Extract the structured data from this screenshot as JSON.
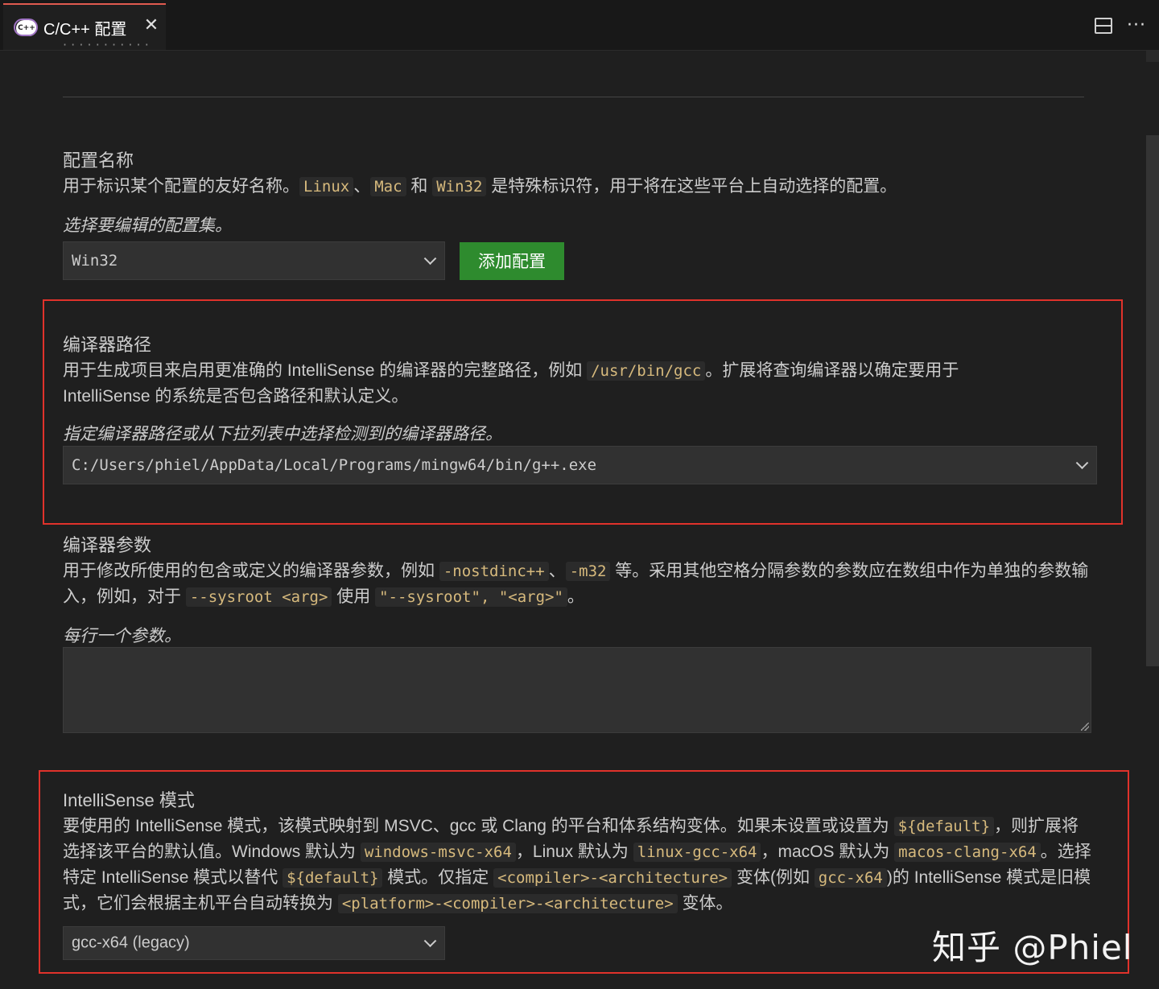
{
  "tab": {
    "icon_text": "C++",
    "title": "C/C++ 配置",
    "close_glyph": "✕"
  },
  "toolbar": {
    "more_glyph": "···"
  },
  "clipped_text": "· · · · · · · · · · ·",
  "config_name": {
    "title": "配置名称",
    "desc_1": "用于标识某个配置的友好名称。",
    "code_linux": "Linux",
    "sep_1": "、",
    "code_mac": "Mac",
    "and": " 和 ",
    "code_win32": "Win32",
    "desc_2": " 是特殊标识符，用于将在这些平台上自动选择的配置。",
    "hint": "选择要编辑的配置集。",
    "selected": "Win32",
    "add_button": "添加配置"
  },
  "compiler_path": {
    "title": "编译器路径",
    "desc_1": "用于生成项目来启用更准确的 IntelliSense 的编译器的完整路径，例如 ",
    "code_example": "/usr/bin/gcc",
    "desc_2": "。扩展将查询编译器以确定要用于 IntelliSense 的系统是否包含路径和默认定义。",
    "hint": "指定编译器路径或从下拉列表中选择检测到的编译器路径。",
    "selected": "C:/Users/phiel/AppData/Local/Programs/mingw64/bin/g++.exe"
  },
  "compiler_args": {
    "title": "编译器参数",
    "desc_1": "用于修改所使用的包含或定义的编译器参数，例如 ",
    "code_1": "-nostdinc++",
    "sep_1": "、",
    "code_2": "-m32",
    "desc_2": " 等。采用其他空格分隔参数的参数应在数组中作为单独的参数输入，例如，对于 ",
    "code_3": "--sysroot <arg>",
    "desc_3": " 使用 ",
    "code_4": "\"--sysroot\", \"<arg>\"",
    "desc_4": "。",
    "hint": "每行一个参数。",
    "value": ""
  },
  "intellisense": {
    "title": "IntelliSense 模式",
    "desc_1": "要使用的 IntelliSense 模式，该模式映射到 MSVC、gcc 或 Clang 的平台和体系结构变体。如果未设置或设置为 ",
    "code_1": "${default}",
    "desc_2": "，则扩展将选择该平台的默认值。Windows 默认为 ",
    "code_2": "windows-msvc-x64",
    "desc_3": "，Linux 默认为 ",
    "code_3": "linux-gcc-x64",
    "desc_4": "，macOS 默认为 ",
    "code_4": "macos-clang-x64",
    "desc_5": "。选择特定 IntelliSense 模式以替代 ",
    "code_5": "${default}",
    "desc_6": " 模式。仅指定 ",
    "code_6": "<compiler>-<architecture>",
    "desc_7": " 变体(例如 ",
    "code_7": "gcc-x64",
    "desc_8": ")的 IntelliSense 模式是旧模式，它们会根据主机平台自动转换为 ",
    "code_8": "<platform>-<compiler>-<architecture>",
    "desc_9": " 变体。",
    "selected": "gcc-x64 (legacy)"
  },
  "watermark": "知乎 @Phiel",
  "colors": {
    "background": "#1f1f1f",
    "code_text": "#d7ba7d",
    "add_button": "#2e8b2e",
    "highlight_box": "#e0322b",
    "tab_accent": "#e05a4f"
  }
}
